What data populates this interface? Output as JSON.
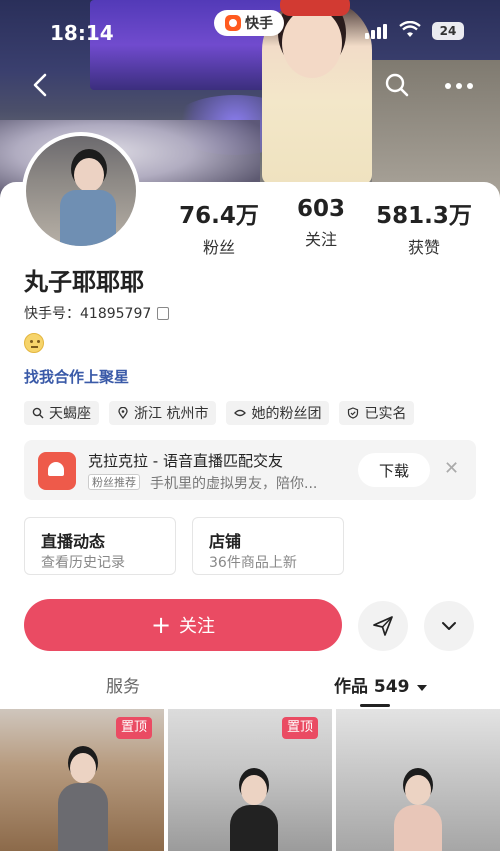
{
  "status_bar": {
    "time": "18:14",
    "app_name": "快手",
    "battery": "24"
  },
  "profile": {
    "name": "丸子耶耶耶",
    "kuaishou_id": "快手号：41895797",
    "cooperation_link": "找我合作上聚星"
  },
  "stats": [
    {
      "value": "76.4万",
      "label": "粉丝"
    },
    {
      "value": "603",
      "label": "关注"
    },
    {
      "value": "581.3万",
      "label": "获赞"
    }
  ],
  "tags": [
    {
      "icon": "search-icon",
      "label": "天蝎座"
    },
    {
      "icon": "location-icon",
      "label": "浙江 杭州市"
    },
    {
      "icon": "fan-group-icon",
      "label": "她的粉丝团"
    },
    {
      "icon": "verified-shield-icon",
      "label": "已实名"
    }
  ],
  "promo": {
    "title": "克拉克拉 - 语音直播匹配交友",
    "badge": "粉丝推荐",
    "description": "手机里的虚拟男友，陪你...",
    "download_label": "下载",
    "close": "✕"
  },
  "boxes": [
    {
      "title": "直播动态",
      "subtitle": "查看历史记录"
    },
    {
      "title": "店铺",
      "subtitle": "36件商品上新"
    }
  ],
  "actions": {
    "follow_label": "关注",
    "follow_plus": "+"
  },
  "tabs": {
    "services": "服务",
    "works": "作品 549"
  },
  "grid": {
    "pinned_label": "置顶"
  },
  "colors": {
    "accent": "#ea4b63",
    "link": "#3a5aa8"
  }
}
